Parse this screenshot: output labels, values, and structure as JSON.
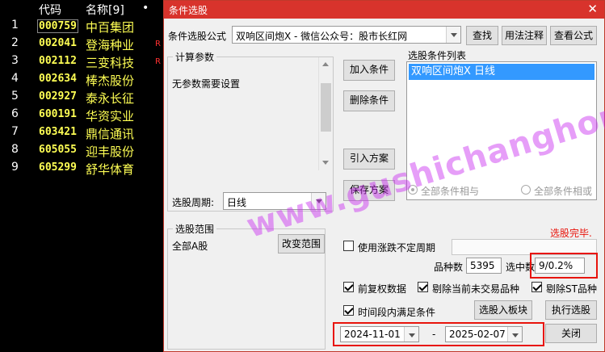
{
  "stock_list": {
    "header": {
      "no": "",
      "code": "代码",
      "name": "名称[9]",
      "dot": "•"
    },
    "rows": [
      {
        "no": "1",
        "code": "000759",
        "name": "中百集团",
        "mark": ""
      },
      {
        "no": "2",
        "code": "002041",
        "name": "登海种业",
        "mark": "R"
      },
      {
        "no": "3",
        "code": "002112",
        "name": "三变科技",
        "mark": "R"
      },
      {
        "no": "4",
        "code": "002634",
        "name": "棒杰股份",
        "mark": ""
      },
      {
        "no": "5",
        "code": "002927",
        "name": "泰永长征",
        "mark": ""
      },
      {
        "no": "6",
        "code": "600191",
        "name": "华资实业",
        "mark": ""
      },
      {
        "no": "7",
        "code": "603421",
        "name": "鼎信通讯",
        "mark": ""
      },
      {
        "no": "8",
        "code": "605055",
        "name": "迎丰股份",
        "mark": ""
      },
      {
        "no": "9",
        "code": "605299",
        "name": "舒华体育",
        "mark": ""
      }
    ]
  },
  "dialog": {
    "title": "条件选股",
    "close": "✕",
    "formula_label": "条件选股公式",
    "formula_value": "双响区间炮X  -  微信公众号：股市长红网",
    "find_button": "查找",
    "usage_button": "用法注释",
    "view_formula_button": "查看公式",
    "params_group": "计算参数",
    "params_text": "无参数需要设置",
    "add_condition_button": "加入条件",
    "delete_condition_button": "删除条件",
    "import_plan_button": "引入方案",
    "save_plan_button": "保存方案",
    "condition_list_label": "选股条件列表",
    "condition_items": [
      "双响区间炮X  日线"
    ],
    "period_label": "选股周期:",
    "period_value": "日线",
    "radio_and": "全部条件相与",
    "radio_or": "全部条件相或",
    "status_text": "选股完毕.",
    "range_group": "选股范围",
    "range_value": "全部A股",
    "change_range_button": "改变范围",
    "use_limit_label": "使用涨跌不定周期",
    "count_label": "品种数",
    "count_value": "5395",
    "selected_label": "选中数",
    "selected_value": "9/0.2%",
    "prev_rights_label": "前复权数据",
    "remove_untraded_label": "剔除当前未交易品种",
    "remove_st_label": "剔除ST品种",
    "time_range_label": "时间段内满足条件",
    "to_board_button": "选股入板块",
    "execute_button": "执行选股",
    "start_date": "2024-11-01",
    "date_sep": "-",
    "end_date": "2025-02-07",
    "close_button": "关闭"
  },
  "watermark": "www.gushichanghong.com",
  "colors": {
    "accent_red": "#d8332c",
    "highlight_yellow": "#ffff54",
    "selection_blue": "#3399ff",
    "watermark": "#c828f0"
  }
}
